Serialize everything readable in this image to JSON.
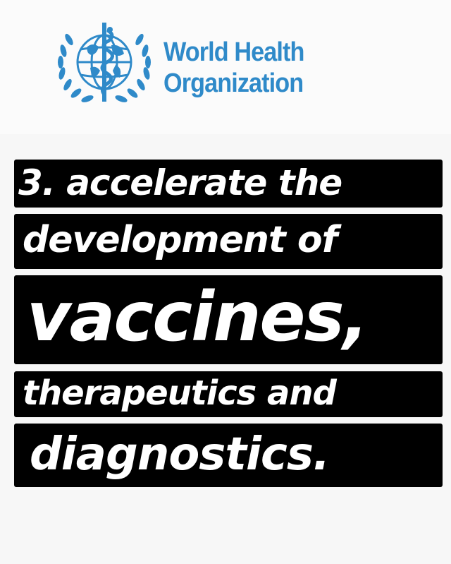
{
  "organization": {
    "name_line_1": "World Health",
    "name_line_2": "Organization",
    "brand_color": "#2f8ac9",
    "emblem_icon": "who-emblem-icon"
  },
  "statement": {
    "line_1": "3. accelerate the",
    "line_2": "development of",
    "line_3": "vaccines,",
    "line_4": "therapeutics and",
    "line_5": "diagnostics."
  },
  "colors": {
    "text_background": "#000000",
    "text_color": "#ffffff",
    "page_background": "#f7f7f7"
  }
}
